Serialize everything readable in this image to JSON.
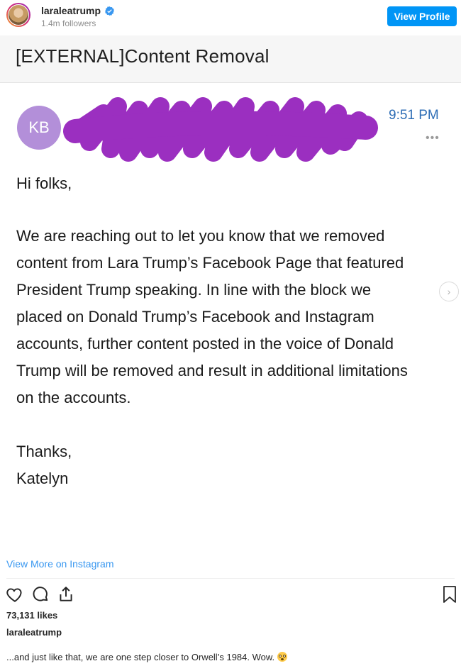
{
  "header": {
    "username": "laraleatrump",
    "followers": "1.4m followers",
    "view_profile": "View Profile"
  },
  "email": {
    "subject": "[EXTERNAL]Content Removal",
    "sender_initials": "KB",
    "time": "9:51 PM",
    "more": "•••",
    "greeting": "Hi folks,",
    "paragraph_lines": [
      "We are reaching out to let you know that we removed",
      "content from Lara Trump’s Facebook Page that featured",
      "President Trump speaking. In line with the block we",
      "placed on Donald Trump’s Facebook and Instagram",
      "accounts, further content posted in the voice of Donald",
      "Trump will be removed and result in additional limitations",
      "on the accounts."
    ],
    "closing": [
      "Thanks,",
      "Katelyn"
    ],
    "next_arrow": "›"
  },
  "footer": {
    "view_more": "View More on Instagram",
    "likes": "73,131 likes",
    "caption_user": "laraleatrump",
    "caption": "...and just like that, we are one step closer to Orwell’s 1984. Wow. "
  },
  "icons": {
    "verified": "verified-badge-icon",
    "like": "heart-icon",
    "comment": "comment-icon",
    "share": "share-icon",
    "save": "bookmark-icon",
    "emoji": "astonished-face-emoji"
  },
  "colors": {
    "accent": "#0095f6",
    "link": "#3897f0",
    "time": "#2d6db5",
    "avatar_kb": "#b38fd9",
    "redaction": "#9b2fc0"
  }
}
